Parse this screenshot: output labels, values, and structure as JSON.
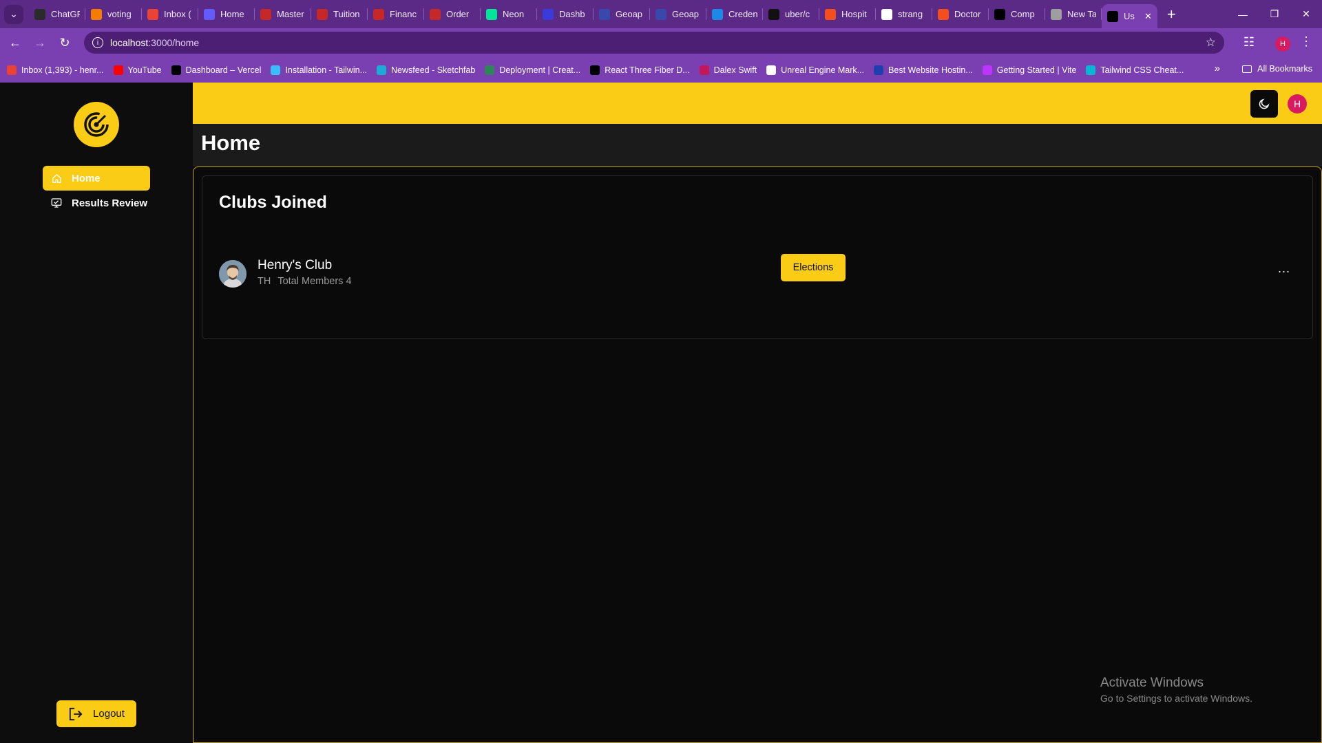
{
  "browser": {
    "tabs": [
      {
        "title": "ChatGPT",
        "icon": "openai-icon",
        "color": "#2b2b2b"
      },
      {
        "title": "voting",
        "icon": "firebase-icon",
        "color": "#f57c00"
      },
      {
        "title": "Inbox (",
        "icon": "gmail-icon",
        "color": "#ea4335"
      },
      {
        "title": "Home",
        "icon": "stripe-icon",
        "color": "#635bff"
      },
      {
        "title": "Master",
        "icon": "mail-icon",
        "color": "#c62828"
      },
      {
        "title": "Tuition",
        "icon": "mail-icon",
        "color": "#c62828"
      },
      {
        "title": "Financ",
        "icon": "mail-icon",
        "color": "#c62828"
      },
      {
        "title": "Order",
        "icon": "mail-icon",
        "color": "#c62828"
      },
      {
        "title": "Neon",
        "icon": "neon-icon",
        "color": "#00e599"
      },
      {
        "title": "Dashb",
        "icon": "clerk-icon",
        "color": "#3b3bdb"
      },
      {
        "title": "Geoap",
        "icon": "geoapify-icon",
        "color": "#3949ab"
      },
      {
        "title": "Geoap",
        "icon": "geoapify-icon",
        "color": "#3949ab"
      },
      {
        "title": "Creden",
        "icon": "api-icon",
        "color": "#1e88e5"
      },
      {
        "title": "uber/c",
        "icon": "github-icon",
        "color": "#111111"
      },
      {
        "title": "Hospit",
        "icon": "figma-icon",
        "color": "#f24e1e"
      },
      {
        "title": "strang",
        "icon": "notion-icon",
        "color": "#ffffff"
      },
      {
        "title": "Doctor",
        "icon": "figma-icon",
        "color": "#f24e1e"
      },
      {
        "title": "Comp",
        "icon": "vercel-icon",
        "color": "#000000"
      },
      {
        "title": "New Ta",
        "icon": "chrome-icon",
        "color": "#9e9e9e"
      },
      {
        "title": "Us",
        "icon": "vercel-icon",
        "color": "#000000",
        "active": true
      }
    ],
    "url_host": "localhost",
    "url_path": ":3000/home",
    "profile_initial": "H",
    "bookmarks": [
      {
        "label": "Inbox (1,393) - henr...",
        "color": "#ea4335"
      },
      {
        "label": "YouTube",
        "color": "#ff0000"
      },
      {
        "label": "Dashboard – Vercel",
        "color": "#000000"
      },
      {
        "label": "Installation - Tailwin...",
        "color": "#38bdf8"
      },
      {
        "label": "Newsfeed - Sketchfab",
        "color": "#1caad9"
      },
      {
        "label": "Deployment | Creat...",
        "color": "#2f855a"
      },
      {
        "label": "React Three Fiber D...",
        "color": "#000000"
      },
      {
        "label": "Dalex Swift",
        "color": "#c2185b"
      },
      {
        "label": "Unreal Engine Mark...",
        "color": "#ffffff"
      },
      {
        "label": "Best Website Hostin...",
        "color": "#1e40af"
      },
      {
        "label": "Getting Started | Vite",
        "color": "#bd34fe"
      },
      {
        "label": "Tailwind CSS Cheat...",
        "color": "#06b6d4"
      }
    ],
    "all_bookmarks": "All Bookmarks"
  },
  "app": {
    "accent_color": "#facc15",
    "nav": [
      {
        "label": "Home",
        "icon": "home-icon",
        "active": true
      },
      {
        "label": "Results Review",
        "icon": "monitor-icon",
        "active": false
      }
    ],
    "logout_label": "Logout",
    "user_initial": "H",
    "page_title": "Home",
    "card_title": "Clubs Joined",
    "club": {
      "name": "Henry's Club",
      "initials": "TH",
      "members_text": "Total Members 4",
      "action_label": "Elections",
      "more": "..."
    }
  },
  "watermark": {
    "line1": "Activate Windows",
    "line2": "Go to Settings to activate Windows."
  }
}
